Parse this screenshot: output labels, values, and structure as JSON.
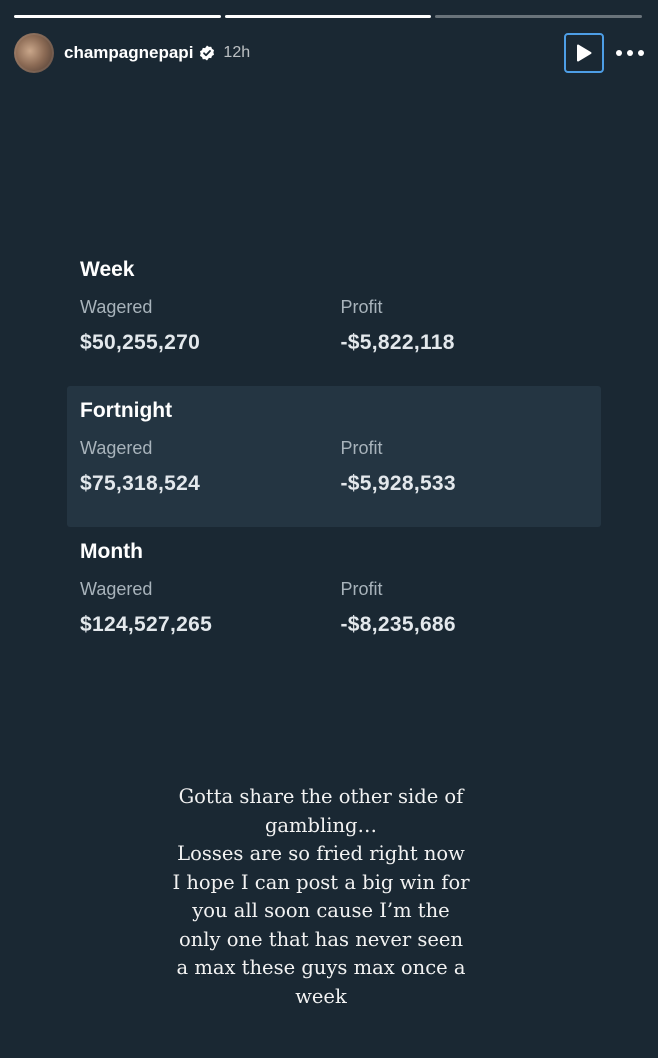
{
  "story": {
    "progress": [
      1.0,
      1.0,
      0.0
    ],
    "username": "champagnepapi",
    "time_ago": "12h",
    "icons": {
      "verified": "verified-badge-icon",
      "play": "play-icon",
      "more": "more-options-icon"
    }
  },
  "stats": {
    "week": {
      "title": "Week",
      "wagered_label": "Wagered",
      "wagered_value": "$50,255,270",
      "profit_label": "Profit",
      "profit_value": "-$5,822,118"
    },
    "fortnight": {
      "title": "Fortnight",
      "wagered_label": "Wagered",
      "wagered_value": "$75,318,524",
      "profit_label": "Profit",
      "profit_value": "-$5,928,533"
    },
    "month": {
      "title": "Month",
      "wagered_label": "Wagered",
      "wagered_value": "$124,527,265",
      "profit_label": "Profit",
      "profit_value": "-$8,235,686"
    }
  },
  "caption": [
    "Gotta share the other side of",
    "gambling…",
    "Losses are so fried right now",
    "I hope I can post a big win for",
    "you all soon cause I’m the",
    "only one that has never seen",
    "a max these guys max once a",
    "week"
  ],
  "colors": {
    "background": "#1a2833",
    "highlight_row": "#243542",
    "play_outline": "#4d9ee6"
  }
}
